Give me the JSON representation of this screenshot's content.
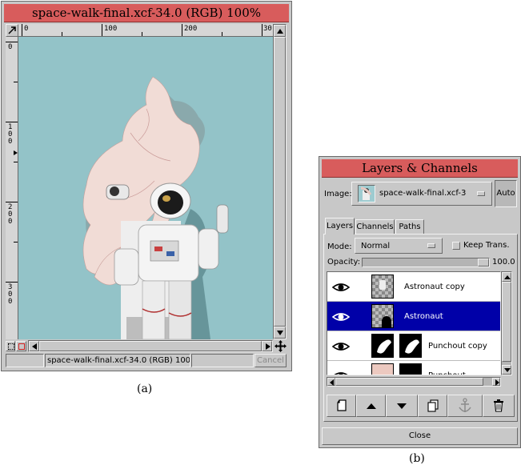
{
  "image_window": {
    "title": "space-walk-final.xcf-34.0 (RGB) 100%",
    "h_ruler": [
      "0",
      "100",
      "200",
      "30"
    ],
    "v_ruler": [
      "0",
      "100",
      "200",
      "300"
    ],
    "status_text": "space-walk-final.xcf-34.0 (RGB) 100",
    "cancel_label": "Cancel",
    "canvas_color": "#93c3c8"
  },
  "layers_dialog": {
    "title": "Layers & Channels",
    "image_label": "Image:",
    "image_value": "space-walk-final.xcf-3",
    "auto_label": "Auto",
    "tabs": [
      "Layers",
      "Channels",
      "Paths"
    ],
    "mode_label": "Mode:",
    "mode_value": "Normal",
    "keep_trans_label": "Keep Trans.",
    "opacity_label": "Opacity:",
    "opacity_value": "100.0",
    "opacity_fraction": 1.0,
    "layers": [
      {
        "name": "Astronaut copy",
        "selected": false
      },
      {
        "name": "Astronaut",
        "selected": true
      },
      {
        "name": "Punchout copy",
        "selected": false
      },
      {
        "name": "Punchout",
        "selected": false
      }
    ],
    "toolbar_icons": [
      "new-layer-icon",
      "raise-layer-icon",
      "lower-layer-icon",
      "duplicate-layer-icon",
      "anchor-layer-icon",
      "delete-layer-icon"
    ],
    "close_label": "Close",
    "selection_color": "#0000a8"
  },
  "captions": {
    "a": "(a)",
    "b": "(b)"
  }
}
